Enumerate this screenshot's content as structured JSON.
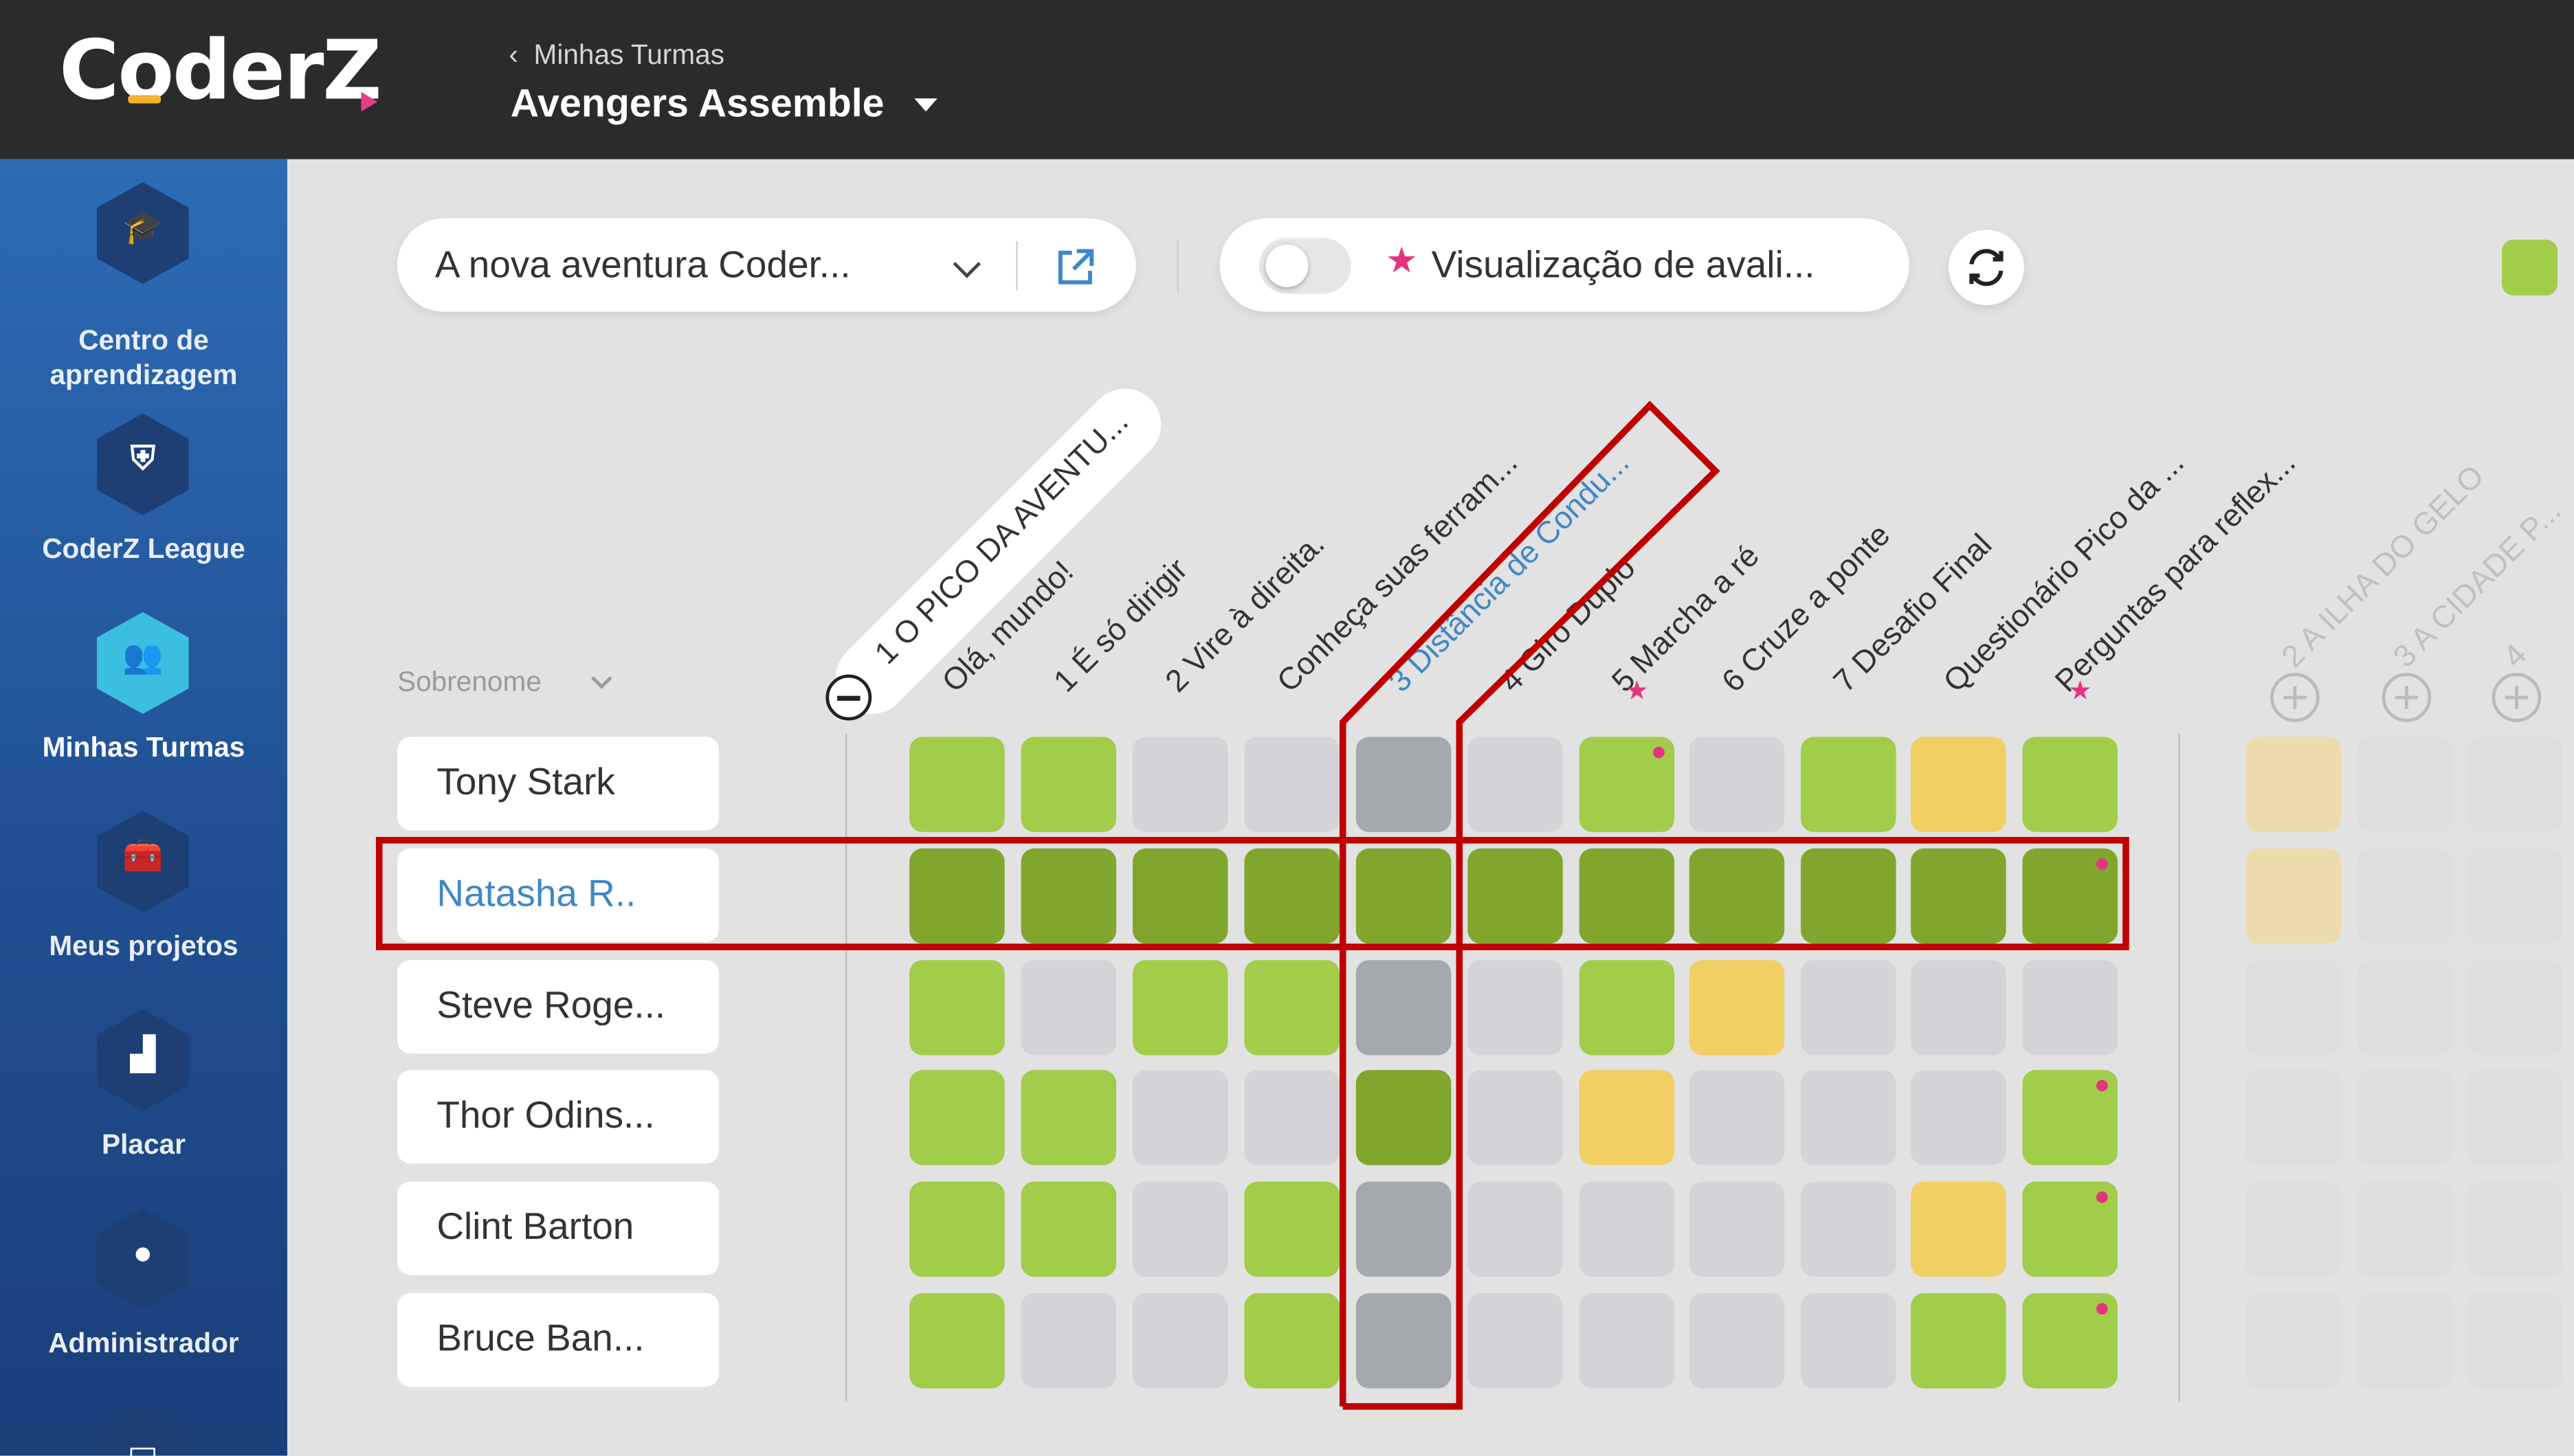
{
  "header": {
    "logo": "CoderZ",
    "breadcrumb": "Minhas Turmas",
    "class_name": "Avengers Assemble"
  },
  "sidebar": {
    "items": [
      {
        "label": "Centro de aprendizagem",
        "icon": "graduation-cap-icon",
        "active": false
      },
      {
        "label": "CoderZ League",
        "icon": "shield-icon",
        "active": false
      },
      {
        "label": "Minhas Turmas",
        "icon": "group-icon",
        "active": true
      },
      {
        "label": "Meus projetos",
        "icon": "toolbox-icon",
        "active": false
      },
      {
        "label": "Placar",
        "icon": "podium-icon",
        "active": false
      },
      {
        "label": "Administrador",
        "icon": "admin-user-icon",
        "active": false
      }
    ]
  },
  "toolbar": {
    "course_select": "A nova aventura Coder...",
    "grade_view_label": "Visualização de avali...",
    "grade_view_toggle": false
  },
  "table": {
    "sort_label": "Sobrenome",
    "section_header": "1 O PICO DA AVENTU...",
    "columns": [
      {
        "label": "Olá, mundo!",
        "starred": false,
        "link": false
      },
      {
        "label": "1 É só dirigir",
        "starred": false,
        "link": false
      },
      {
        "label": "2 Vire à direita.",
        "starred": false,
        "link": false
      },
      {
        "label": "Conheça suas ferram...",
        "starred": false,
        "link": false
      },
      {
        "label": "3 Distância de Condu...",
        "starred": false,
        "link": true
      },
      {
        "label": "4 Giro Duplo",
        "starred": false,
        "link": false
      },
      {
        "label": "5 Marcha a ré",
        "starred": true,
        "link": false
      },
      {
        "label": "6 Cruze a ponte",
        "starred": false,
        "link": false
      },
      {
        "label": "7 Desafio Final",
        "starred": false,
        "link": false
      },
      {
        "label": "Questionário Pico da ...",
        "starred": false,
        "link": false
      },
      {
        "label": "Perguntas para reflex...",
        "starred": true,
        "link": false
      }
    ],
    "collapsed_sections": [
      {
        "label": "2 A ILHA DO GELO"
      },
      {
        "label": "3 A CIDADE P..."
      },
      {
        "label": "4"
      }
    ],
    "students": [
      {
        "name": "Tony Stark",
        "link": false,
        "menu": false,
        "cells": [
          "light",
          "light",
          "gray",
          "gray",
          "dark-gray",
          "gray",
          "light*",
          "gray",
          "light",
          "yellow",
          "light"
        ],
        "extra": [
          "pale-yellow",
          "faded",
          "faded"
        ]
      },
      {
        "name": "Natasha R..",
        "link": true,
        "menu": true,
        "cells": [
          "dark",
          "dark",
          "dark",
          "dark",
          "dark",
          "dark",
          "dark",
          "dark",
          "dark",
          "dark",
          "dark*"
        ],
        "extra": [
          "pale-yellow",
          "faded",
          "faded"
        ]
      },
      {
        "name": "Steve Roge...",
        "link": false,
        "menu": false,
        "cells": [
          "light",
          "gray",
          "light",
          "light",
          "dark-gray",
          "gray",
          "light",
          "yellow",
          "gray",
          "gray",
          "gray"
        ],
        "extra": [
          "faded",
          "faded",
          "faded"
        ]
      },
      {
        "name": "Thor Odins...",
        "link": false,
        "menu": false,
        "cells": [
          "light",
          "light",
          "gray",
          "gray",
          "dark",
          "gray",
          "yellow",
          "gray",
          "gray",
          "gray",
          "light*"
        ],
        "extra": [
          "faded",
          "faded",
          "faded"
        ]
      },
      {
        "name": "Clint Barton",
        "link": false,
        "menu": false,
        "cells": [
          "light",
          "light",
          "gray",
          "light",
          "dark-gray",
          "gray",
          "gray",
          "gray",
          "gray",
          "yellow",
          "light*"
        ],
        "extra": [
          "faded",
          "faded",
          "faded"
        ]
      },
      {
        "name": "Bruce Ban...",
        "link": false,
        "menu": false,
        "cells": [
          "light",
          "gray",
          "gray",
          "light",
          "dark-gray",
          "gray",
          "gray",
          "gray",
          "gray",
          "light",
          "light*"
        ],
        "extra": [
          "faded",
          "faded",
          "faded"
        ]
      }
    ]
  },
  "colors": {
    "light": "#a2cd4a",
    "dark": "#81a62d",
    "gray": "#d3d4d7",
    "dark-gray": "#a5a9ae",
    "yellow": "#f1cf62",
    "pale-yellow": "#ecdcab",
    "faded": "#dedede",
    "highlight": "#c00000",
    "accent_pink": "#e5337f"
  }
}
